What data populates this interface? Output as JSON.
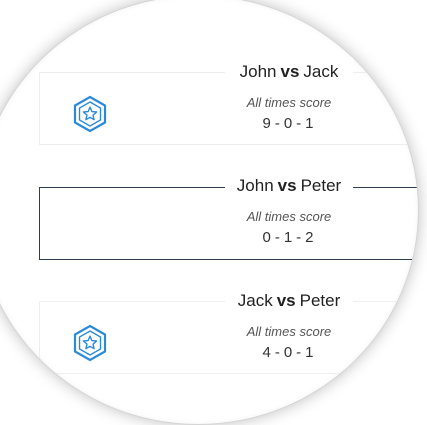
{
  "vs_label": "vs",
  "subtitle": "All times score",
  "colors": {
    "badge_blue": "#2b8ad8",
    "active_border": "#2d3e50",
    "faded_border": "#eeeeee"
  },
  "matchups": [
    {
      "player1": "John",
      "player2": "Jack",
      "score": [
        "9",
        "0",
        "1"
      ],
      "badge": "star-badge-icon",
      "state": "faded"
    },
    {
      "player1": "John",
      "player2": "Peter",
      "score": [
        "0",
        "1",
        "2"
      ],
      "badge": null,
      "state": "active"
    },
    {
      "player1": "Jack",
      "player2": "Peter",
      "score": [
        "4",
        "0",
        "1"
      ],
      "badge": "star-badge-icon",
      "state": "faded"
    }
  ]
}
